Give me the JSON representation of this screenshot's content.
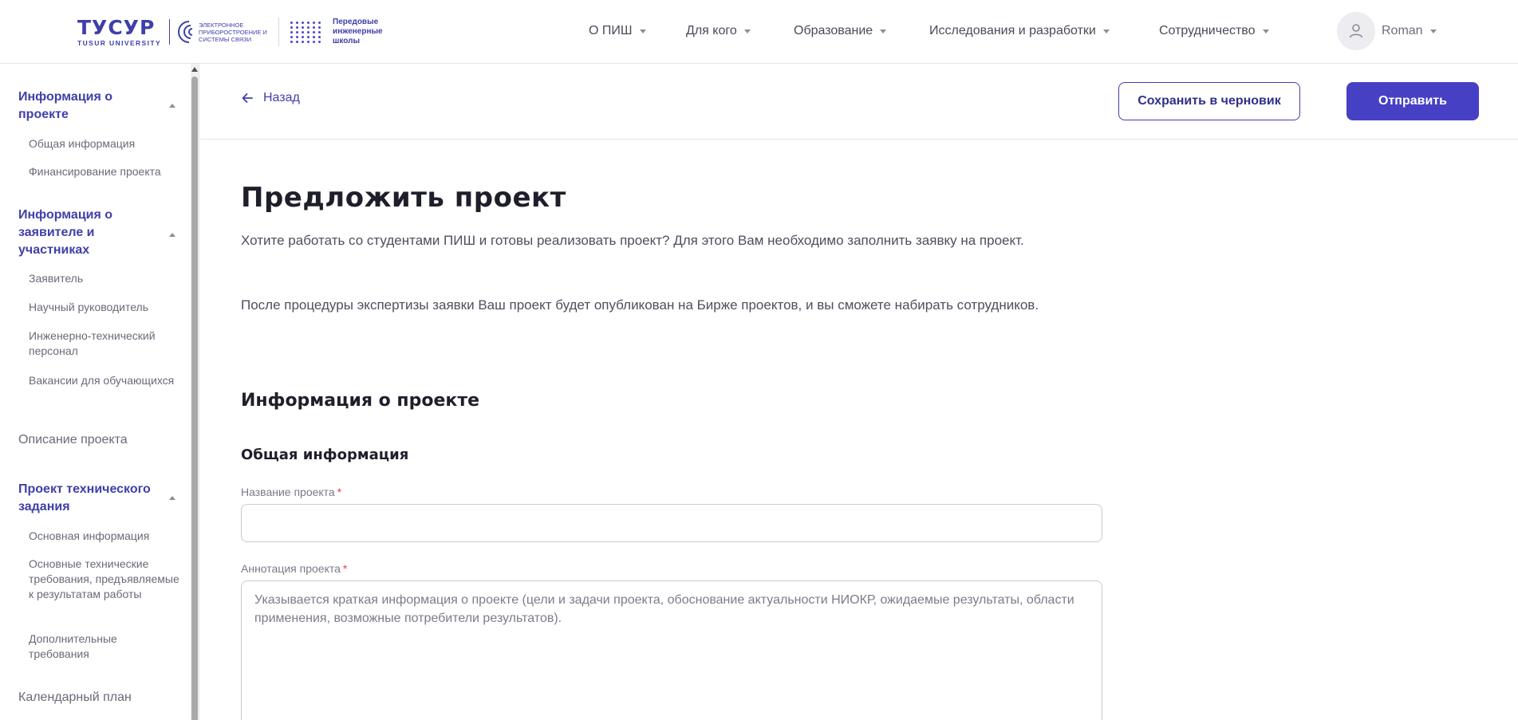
{
  "header": {
    "logo": {
      "word": "ТУСУР",
      "sub": "TUSUR UNIVERSITY",
      "arcs_text": "Электронное приборостроение и системы связи",
      "pish_text_1": "Передовые",
      "pish_text_2": "инженерные",
      "pish_text_3": "школы"
    },
    "nav": [
      {
        "label": "О ПИШ"
      },
      {
        "label": "Для кого"
      },
      {
        "label": "Образование"
      },
      {
        "label": "Исследования и разработки"
      },
      {
        "label": "Сотрудничество"
      }
    ],
    "user": {
      "name": "Roman",
      "icon": "user-icon"
    }
  },
  "sidebar": {
    "sections": [
      {
        "title": "Информация о проекте",
        "items": [
          "Общая информация",
          "Финансирование проекта"
        ]
      },
      {
        "title": "Информация о заявителе и участниках",
        "items": [
          "Заявитель",
          "Научный руководитель",
          "Инженерно-технический персонал",
          "Вакансии для обучающихся"
        ]
      },
      {
        "title": "Описание проекта"
      },
      {
        "title": "Проект технического задания",
        "items": [
          "Основная информация",
          "Основные технические требования, предъявляемые к результатам работы",
          "Дополнительные требования"
        ]
      },
      {
        "title": "Календарный план"
      }
    ]
  },
  "toolbar": {
    "back_label": "Назад",
    "draft_label": "Сохранить в черновик",
    "send_label": "Отправить"
  },
  "main": {
    "title": "Предложить проект",
    "intro_1": "Хотите работать со студентами ПИШ и готовы реализовать проект? Для этого Вам необходимо заполнить заявку на проект.",
    "intro_2": "После процедуры экспертизы заявки Ваш проект будет опубликован на Бирже проектов, и вы сможете набирать сотрудников.",
    "section_title": "Информация о проекте",
    "subsection_title": "Общая информация",
    "fields": {
      "name_label": "Название проекта",
      "name_value": "",
      "annotation_label": "Аннотация проекта",
      "annotation_placeholder": "Указывается краткая информация о проекте (цели и задачи проекта, обоснование актуальности НИОКР, ожидаемые результаты, области применения, возможные потребители результатов).",
      "required_mark": "*"
    }
  },
  "colors": {
    "brand": "#3f3faa",
    "primary_button": "#4640c4",
    "required": "#e0453f"
  }
}
